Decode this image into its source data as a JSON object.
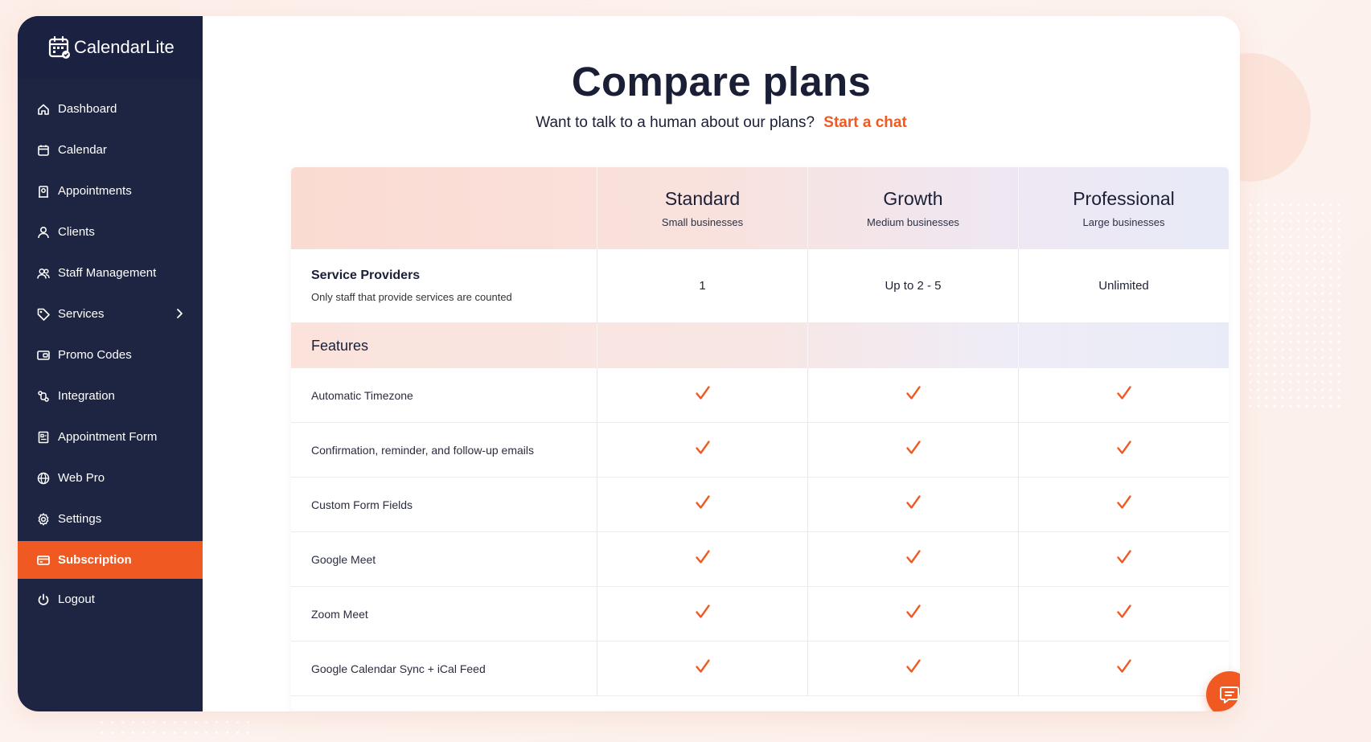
{
  "app": {
    "name": "CalendarLite"
  },
  "sidebar": {
    "items": [
      {
        "label": "Dashboard",
        "icon": "home-icon"
      },
      {
        "label": "Calendar",
        "icon": "calendar-icon"
      },
      {
        "label": "Appointments",
        "icon": "appointments-icon"
      },
      {
        "label": "Clients",
        "icon": "user-icon"
      },
      {
        "label": "Staff Management",
        "icon": "users-icon"
      },
      {
        "label": "Services",
        "icon": "tag-icon"
      },
      {
        "label": "Promo Codes",
        "icon": "ticket-icon"
      },
      {
        "label": "Integration",
        "icon": "integration-icon"
      },
      {
        "label": "Appointment Form",
        "icon": "form-icon"
      },
      {
        "label": "Web Pro",
        "icon": "globe-icon"
      },
      {
        "label": "Settings",
        "icon": "gear-icon"
      },
      {
        "label": "Subscription",
        "icon": "card-icon",
        "active": true
      },
      {
        "label": "Logout",
        "icon": "power-icon"
      }
    ]
  },
  "main": {
    "title": "Compare plans",
    "subtitle": "Want to talk to a human about our plans?",
    "chat_link": "Start a chat"
  },
  "plans": [
    {
      "name": "Standard",
      "subtitle": "Small businesses"
    },
    {
      "name": "Growth",
      "subtitle": "Medium businesses"
    },
    {
      "name": "Professional",
      "subtitle": "Large businesses"
    }
  ],
  "providers": {
    "title": "Service Providers",
    "subtitle": "Only staff that provide services are counted",
    "values": [
      "1",
      "Up to 2 - 5",
      "Unlimited"
    ]
  },
  "features": {
    "title": "Features",
    "rows": [
      {
        "label": "Automatic Timezone",
        "included": [
          true,
          true,
          true
        ]
      },
      {
        "label": "Confirmation, reminder, and follow-up emails",
        "included": [
          true,
          true,
          true
        ]
      },
      {
        "label": "Custom Form Fields",
        "included": [
          true,
          true,
          true
        ]
      },
      {
        "label": "Google Meet",
        "included": [
          true,
          true,
          true
        ]
      },
      {
        "label": "Zoom Meet",
        "included": [
          true,
          true,
          true
        ]
      },
      {
        "label": "Google Calendar Sync + iCal Feed",
        "included": [
          true,
          true,
          true
        ]
      }
    ]
  },
  "colors": {
    "accent": "#f05a22",
    "sidebar_bg": "#1e2542",
    "text_dark": "#1a1f36"
  }
}
